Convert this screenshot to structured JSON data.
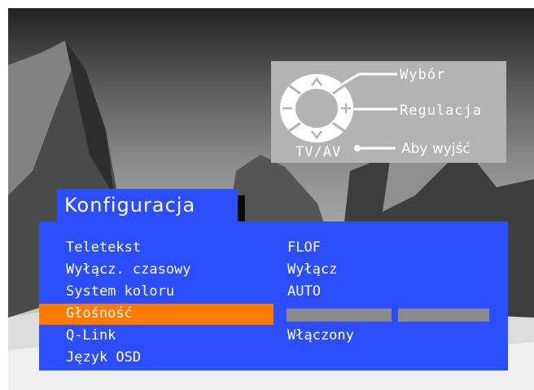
{
  "help": {
    "wybor": "Wybór",
    "regulacja": "Regulacja",
    "exit": "Aby wyjść",
    "tvav": "TV/AV"
  },
  "title": "Konfiguracja",
  "menu": {
    "items": [
      {
        "label": "Teletekst",
        "value": "FLOF"
      },
      {
        "label": "Wyłącz. czasowy",
        "value": "Wyłącz"
      },
      {
        "label": "System koloru",
        "value": "AUTO"
      },
      {
        "label": "Głośność",
        "value": ""
      },
      {
        "label": "Q-Link",
        "value": "Włączony"
      },
      {
        "label": "Język OSD",
        "value": ""
      }
    ],
    "selected_index": 3
  },
  "colors": {
    "menu_bg": "#2b4dfa",
    "selection": "#ff7a00",
    "help_bg": "#b3b3b3"
  }
}
